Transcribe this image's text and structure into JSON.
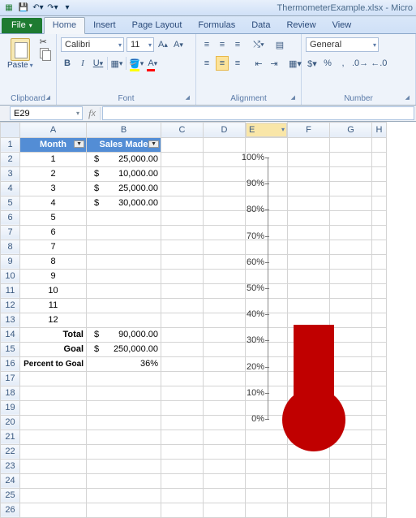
{
  "window": {
    "title": "ThermometerExample.xlsx - Micro"
  },
  "qat": {
    "save": "save",
    "undo": "undo",
    "redo": "redo"
  },
  "tabs": {
    "file": "File",
    "home": "Home",
    "insert": "Insert",
    "pagelayout": "Page Layout",
    "formulas": "Formulas",
    "data": "Data",
    "review": "Review",
    "view": "View"
  },
  "ribbon": {
    "clipboard": {
      "title": "Clipboard",
      "paste": "Paste"
    },
    "font": {
      "title": "Font",
      "name": "Calibri",
      "size": "11"
    },
    "align": {
      "title": "Alignment"
    },
    "number": {
      "title": "Number",
      "format": "General"
    }
  },
  "namebox": "E29",
  "columns": [
    "A",
    "B",
    "C",
    "D",
    "E",
    "F",
    "G",
    "H"
  ],
  "header": {
    "month": "Month",
    "sales": "Sales Made"
  },
  "rows": [
    {
      "m": "1",
      "v": "25,000.00"
    },
    {
      "m": "2",
      "v": "10,000.00"
    },
    {
      "m": "3",
      "v": "25,000.00"
    },
    {
      "m": "4",
      "v": "30,000.00"
    },
    {
      "m": "5",
      "v": ""
    },
    {
      "m": "6",
      "v": ""
    },
    {
      "m": "7",
      "v": ""
    },
    {
      "m": "8",
      "v": ""
    },
    {
      "m": "9",
      "v": ""
    },
    {
      "m": "10",
      "v": ""
    },
    {
      "m": "11",
      "v": ""
    },
    {
      "m": "12",
      "v": ""
    }
  ],
  "summary": {
    "total_label": "Total",
    "total_val": "90,000.00",
    "goal_label": "Goal",
    "goal_val": "250,000.00",
    "pct_label": "Percent to Goal",
    "pct_val": "36%"
  },
  "chart_data": {
    "type": "bar",
    "categories": [
      "Percent to Goal"
    ],
    "values": [
      36
    ],
    "ylabel": "",
    "ylim": [
      0,
      100
    ],
    "yticks": [
      0,
      10,
      20,
      30,
      40,
      50,
      60,
      70,
      80,
      90,
      100
    ],
    "yticklabels": [
      "0%",
      "10%",
      "20%",
      "30%",
      "40%",
      "50%",
      "60%",
      "70%",
      "80%",
      "90%",
      "100%"
    ],
    "color": "#c00000"
  }
}
